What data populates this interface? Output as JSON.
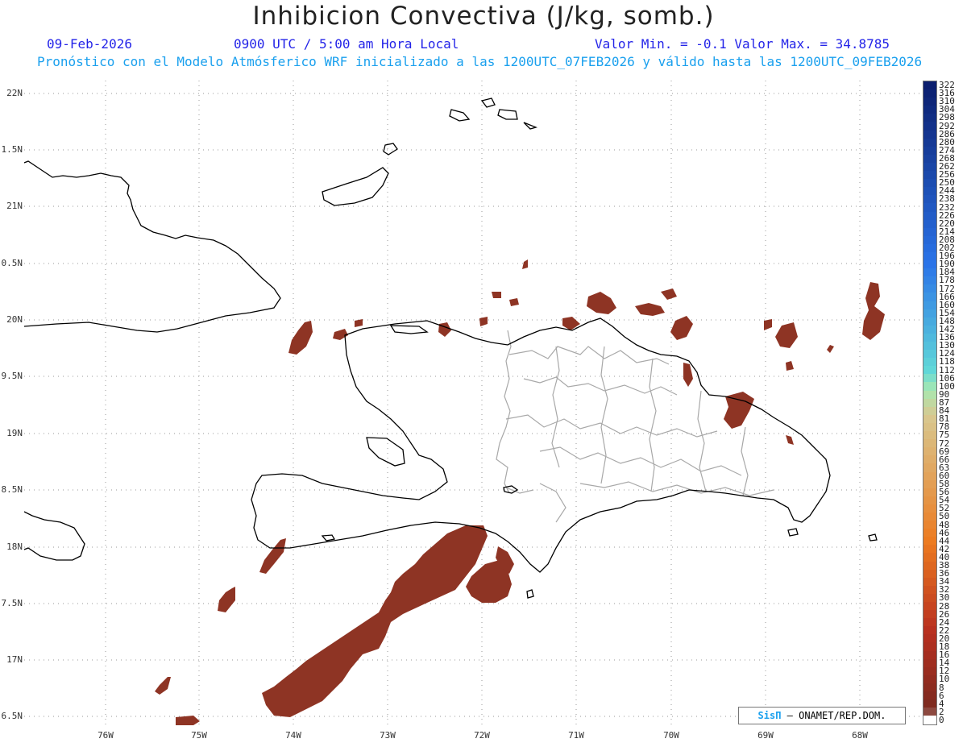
{
  "header": {
    "title": "Inhibicion Convectiva (J/kg, somb.)",
    "date": "09-Feb-2026",
    "time": "0900 UTC / 5:00 am Hora Local",
    "minmax": "Valor Min. = -0.1  Valor Max. = 34.8785",
    "description": "Pronóstico con el Modelo Atmósferico WRF inicializado a las 1200UTC_07FEB2026 y válido hasta las  1200UTC_09FEB2026"
  },
  "axes": {
    "lat_labels": [
      "22N",
      "1.5N",
      "21N",
      "0.5N",
      "20N",
      "9.5N",
      "19N",
      "8.5N",
      "18N",
      "7.5N",
      "17N",
      "6.5N"
    ],
    "lon_labels": [
      "76W",
      "75W",
      "74W",
      "73W",
      "72W",
      "71W",
      "70W",
      "69W",
      "68W"
    ]
  },
  "legend": {
    "labels": [
      "322",
      "316",
      "310",
      "304",
      "298",
      "292",
      "286",
      "280",
      "274",
      "268",
      "262",
      "256",
      "250",
      "244",
      "238",
      "232",
      "226",
      "220",
      "214",
      "208",
      "202",
      "196",
      "190",
      "184",
      "178",
      "172",
      "166",
      "160",
      "154",
      "148",
      "142",
      "136",
      "130",
      "124",
      "118",
      "112",
      "106",
      "100",
      "90",
      "87",
      "84",
      "81",
      "78",
      "75",
      "72",
      "69",
      "66",
      "63",
      "60",
      "58",
      "56",
      "54",
      "52",
      "50",
      "48",
      "46",
      "44",
      "42",
      "40",
      "38",
      "36",
      "34",
      "32",
      "30",
      "28",
      "26",
      "24",
      "22",
      "20",
      "18",
      "16",
      "14",
      "12",
      "10",
      "8",
      "6",
      "4",
      "2",
      "0"
    ],
    "colors": {
      "top": "#0b1e6e",
      "blue": "#2a73e8",
      "cyan": "#60d8d8",
      "green": "#a8e8b0",
      "tan": "#d8c890",
      "orange": "#ec7a20",
      "red": "#b83020",
      "bottom": "#7a2a20"
    }
  },
  "credit": {
    "brand": "SisΠ",
    "text": " – ONAMET/REP.DOM."
  },
  "colors": {
    "shade": "#8e3424",
    "coast": "#000000",
    "border": "#a8a8a8",
    "grid": "#9a9a9a"
  }
}
